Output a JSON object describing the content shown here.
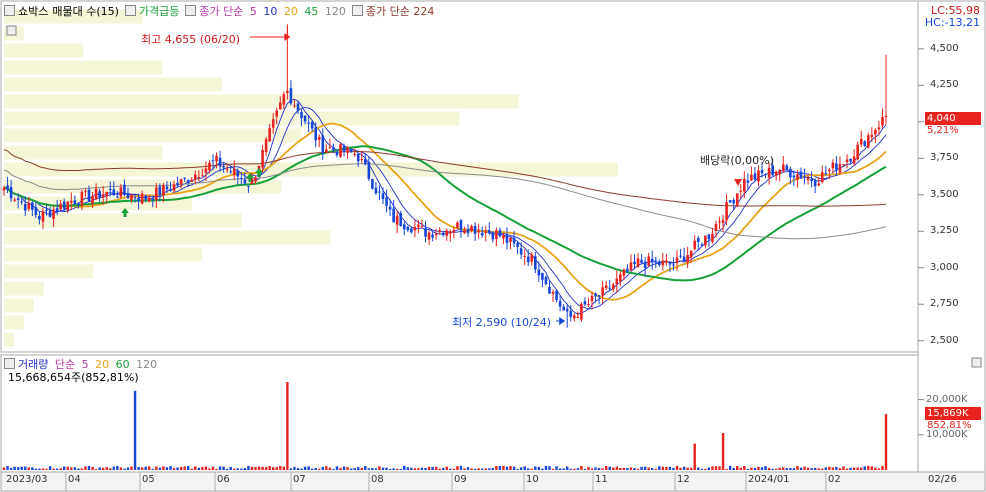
{
  "legend_top": {
    "stock_name": "쇼박스",
    "indicator": "매물대 수(15)",
    "signal": "가격급등",
    "ma_label": "종가 단순",
    "ma_periods": [
      "5",
      "10",
      "20",
      "45",
      "120"
    ],
    "ma_long_label": "종가 단순 224"
  },
  "legend_volume": {
    "title": "거래량",
    "ma_label": "단순",
    "ma_periods": [
      "5",
      "20",
      "60",
      "120"
    ],
    "current": "15,668,654주(852,81%)"
  },
  "right_info": {
    "lc": "LC:55,98",
    "hc": "HC:-13,21"
  },
  "price_badge": {
    "price": "4,040",
    "change": "5,21%"
  },
  "volume_badge": {
    "volume": "15,869K",
    "change": "852,81%"
  },
  "annotations": {
    "high": "최고 4,655 (06/20)",
    "low": "최저 2,590 (10/24)",
    "dividend": "배당락(0,00%)"
  },
  "colors": {
    "up": "#e8231e",
    "down": "#1646d8",
    "ma5": "#2030c8",
    "ma10": "#2030c8",
    "ma20": "#e8a418",
    "ma45": "#18a038",
    "ma120": "#8a8a8a",
    "ma224": "#8b3a2a",
    "volume_profile": "#f5f5d8"
  },
  "chart_data": [
    {
      "type": "candlestick",
      "title": "쇼박스",
      "y_axis_ticks": [
        "4,500",
        "4,250",
        "4,000",
        "3,750",
        "3,500",
        "3,250",
        "3,000",
        "2,750",
        "2,500"
      ],
      "x_axis_ticks": [
        "2023/03",
        "04",
        "05",
        "06",
        "07",
        "08",
        "09",
        "10",
        "11",
        "12",
        "2024/01",
        "02",
        "02/26"
      ],
      "ylim": [
        2450,
        4780
      ],
      "high": {
        "value": 4655,
        "date": "06/20"
      },
      "low": {
        "value": 2590,
        "date": "10/24"
      },
      "last_close": 4040,
      "anchors": [
        {
          "date": "2023/03",
          "close": 3550
        },
        {
          "date": "03 mid",
          "close": 3350
        },
        {
          "date": "04",
          "close": 3470
        },
        {
          "date": "04 mid",
          "close": 3520
        },
        {
          "date": "05",
          "close": 3480
        },
        {
          "date": "05 mid",
          "close": 3580
        },
        {
          "date": "06",
          "close": 3730
        },
        {
          "date": "06 mid",
          "close": 3570
        },
        {
          "date": "06/20",
          "close": 4220
        },
        {
          "date": "07",
          "close": 3830
        },
        {
          "date": "07 mid",
          "close": 3780
        },
        {
          "date": "08",
          "close": 3340
        },
        {
          "date": "08 mid",
          "close": 3240
        },
        {
          "date": "09",
          "close": 3290
        },
        {
          "date": "09 mid",
          "close": 3230
        },
        {
          "date": "10",
          "close": 3050
        },
        {
          "date": "10/24",
          "close": 2650
        },
        {
          "date": "11",
          "close": 2830
        },
        {
          "date": "11 mid",
          "close": 3040
        },
        {
          "date": "12",
          "close": 3020
        },
        {
          "date": "12 mid",
          "close": 3230
        },
        {
          "date": "2024/01",
          "close": 3600
        },
        {
          "date": "01 mid",
          "close": 3680
        },
        {
          "date": "02",
          "close": 3600
        },
        {
          "date": "02 mid",
          "close": 3770
        },
        {
          "date": "02/26",
          "close": 4040
        }
      ],
      "volume_profile_fraction": [
        0.14,
        0.02,
        0.08,
        0.16,
        0.22,
        0.52,
        0.46,
        0.3,
        0.16,
        0.62,
        0.28,
        0.19,
        0.24,
        0.33,
        0.2,
        0.09,
        0.04,
        0.03,
        0.02,
        0.01
      ]
    },
    {
      "type": "bar",
      "title": "거래량",
      "y_axis_ticks": [
        "20,000K",
        "10,000K"
      ],
      "ylim": [
        0,
        27000
      ],
      "unit": "K",
      "last_volume": 15869,
      "spikes_k": [
        {
          "date": "04 late",
          "volume": 22500
        },
        {
          "date": "06/20",
          "volume": 25000
        },
        {
          "date": "12 mid",
          "volume": 7500
        },
        {
          "date": "12 late",
          "volume": 10500
        },
        {
          "date": "02/26",
          "volume": 15869
        }
      ],
      "series": [
        {
          "name": "5"
        },
        {
          "name": "20"
        },
        {
          "name": "60"
        },
        {
          "name": "120"
        }
      ]
    }
  ]
}
